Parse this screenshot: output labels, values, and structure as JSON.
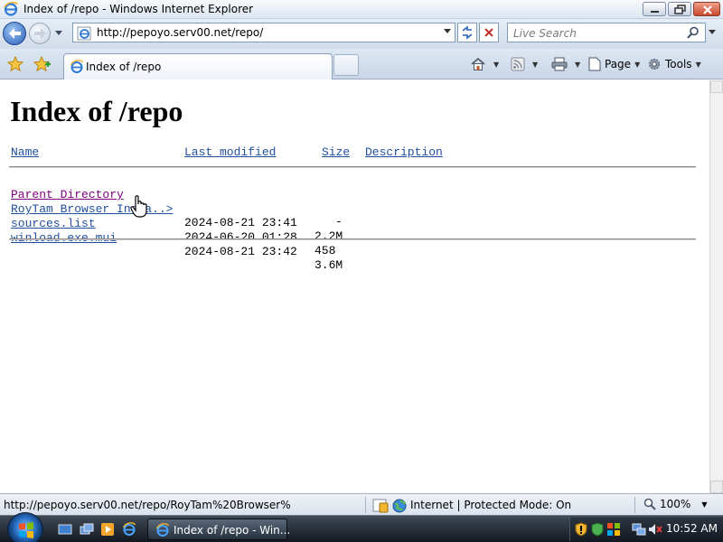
{
  "window": {
    "title": "Index of /repo - Windows Internet Explorer"
  },
  "address_bar": {
    "url": "http://pepoyo.serv00.net/repo/"
  },
  "search": {
    "placeholder": "Live Search"
  },
  "tab": {
    "title": "Index of /repo"
  },
  "command_bar": {
    "page_label": "Page",
    "tools_label": "Tools"
  },
  "page": {
    "heading": "Index of /repo",
    "columns": {
      "name": "Name",
      "last_modified": "Last modified",
      "size": "Size",
      "description": "Description"
    },
    "entries": [
      {
        "name": "Parent Directory",
        "date": "",
        "size": "-"
      },
      {
        "name": "RoyTam Browser Insta..>",
        "date": "2024-08-21 23:41",
        "size": "2.2M"
      },
      {
        "name": "sources.list",
        "date": "2024-06-20 01:28",
        "size": "458"
      },
      {
        "name": "winload.exe.mui",
        "date": "2024-08-21 23:42",
        "size": "3.6M"
      }
    ]
  },
  "status_bar": {
    "url": "http://pepoyo.serv00.net/repo/RoyTam%20Browser%",
    "zone": "Internet | Protected Mode: On",
    "zoom": "100%"
  },
  "taskbar": {
    "window_button": "Index of /repo - Win...",
    "clock": "10:52 AM"
  },
  "colors": {
    "link": "#1f4f9e",
    "visited_link": "#800080"
  }
}
